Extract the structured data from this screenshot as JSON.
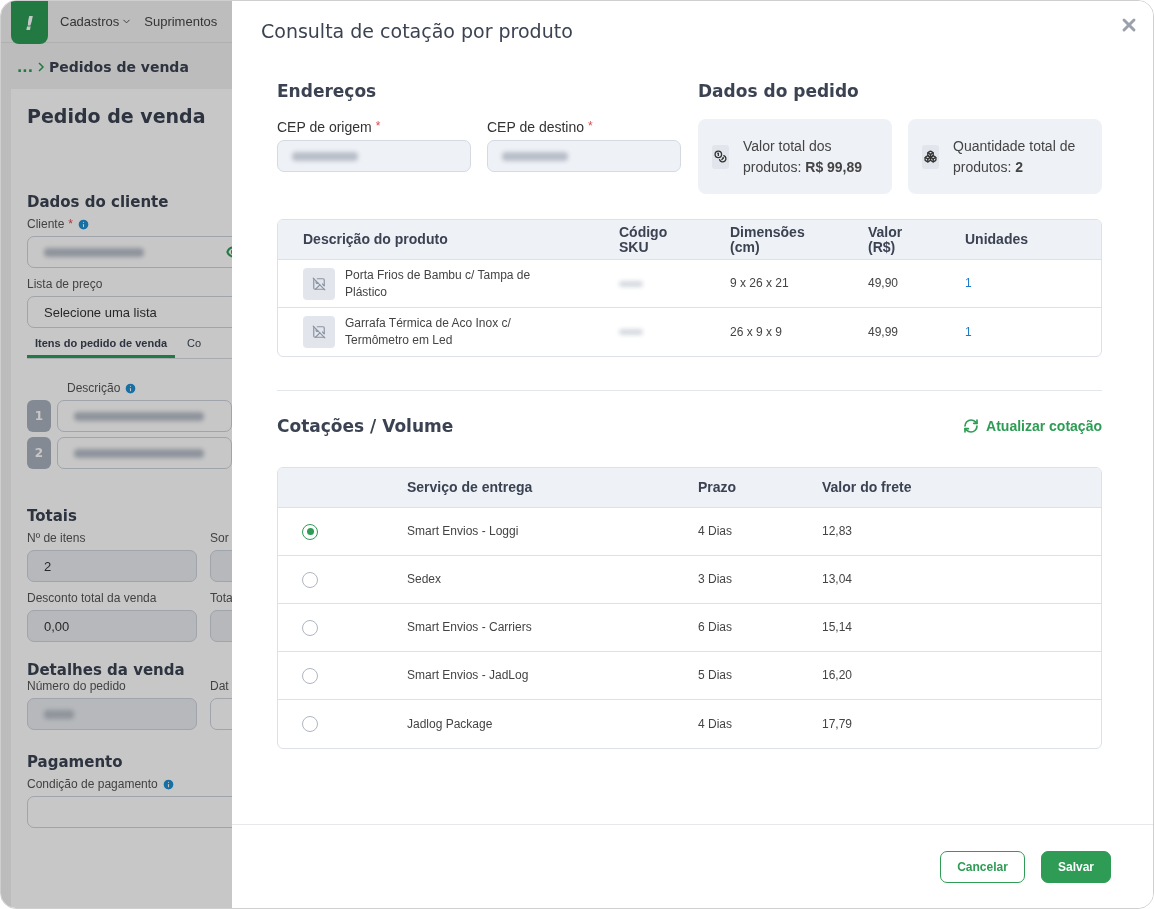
{
  "background_page": {
    "logo": "!",
    "nav": [
      {
        "label": "Cadastros",
        "dropdown": true
      },
      {
        "label": "Suprimentos",
        "dropdown": false
      }
    ],
    "breadcrumb": {
      "ellipsis": "...",
      "current": "Pedidos de venda"
    },
    "title": "Pedido de venda",
    "client_section": {
      "heading": "Dados do cliente",
      "client_label": "Cliente",
      "required_mark": "*",
      "price_list_label": "Lista de preço",
      "price_list_value": "Selecione uma lista"
    },
    "tabs": [
      {
        "label": "Itens do pedido de venda",
        "selected": true
      },
      {
        "label": "Co",
        "selected": false
      }
    ],
    "items": {
      "column": "Descrição",
      "numbers": [
        "1",
        "2"
      ]
    },
    "totals": {
      "heading": "Totais",
      "fields": [
        {
          "label": "Nº de itens",
          "value": "2"
        },
        {
          "label": "Sor"
        },
        {
          "label": "Desconto total da venda",
          "value": "0,00"
        },
        {
          "label": "Tota"
        }
      ]
    },
    "details": {
      "heading": "Detalhes da venda",
      "fields": [
        {
          "label": "Número do pedido"
        },
        {
          "label": "Dat"
        }
      ]
    },
    "payment": {
      "heading": "Pagamento",
      "label": "Condição de pagamento"
    }
  },
  "dialog": {
    "title": "Consulta de cotação por produto",
    "addresses": {
      "heading": "Endereços",
      "required_mark": "*",
      "fields": [
        {
          "label": "CEP de origem"
        },
        {
          "label": "CEP de destino"
        }
      ]
    },
    "order": {
      "heading": "Dados do pedido",
      "cards": [
        {
          "kind": "value",
          "text": "Valor total dos produtos: **R$ 99,89**"
        },
        {
          "kind": "quantity",
          "text": "Quantidade total de produtos: **2**"
        }
      ]
    },
    "products": {
      "columns": [
        "Descrição do produto",
        "Código SKU",
        "Dimensões (cm)",
        "Valor (R$)",
        "Unidades"
      ],
      "rows": [
        {
          "description": "Porta Frios de Bambu c/ Tampa de Plástico",
          "dimensions": "9 x 26 x 21",
          "value": "49,90",
          "units": "1"
        },
        {
          "description": "Garrafa Térmica de Aco Inox c/ Termômetro em Led",
          "dimensions": "26 x 9 x 9",
          "value": "49,99",
          "units": "1"
        }
      ]
    },
    "quotes": {
      "heading": "Cotações / Volume",
      "refresh": "Atualizar cotação",
      "columns": [
        "Serviço de entrega",
        "Prazo",
        "Valor do frete"
      ],
      "rows": [
        {
          "service": "Smart Envios - Loggi",
          "term": "4 Dias",
          "price": "12,83",
          "selected": true
        },
        {
          "service": "Sedex",
          "term": "3 Dias",
          "price": "13,04",
          "selected": false
        },
        {
          "service": "Smart Envios - Carriers",
          "term": "6 Dias",
          "price": "15,14",
          "selected": false
        },
        {
          "service": "Smart Envios - JadLog",
          "term": "5 Dias",
          "price": "16,20",
          "selected": false
        },
        {
          "service": "Jadlog Package",
          "term": "4 Dias",
          "price": "17,79",
          "selected": false
        }
      ]
    },
    "buttons": {
      "cancel": "Cancelar",
      "save": "Salvar"
    }
  }
}
